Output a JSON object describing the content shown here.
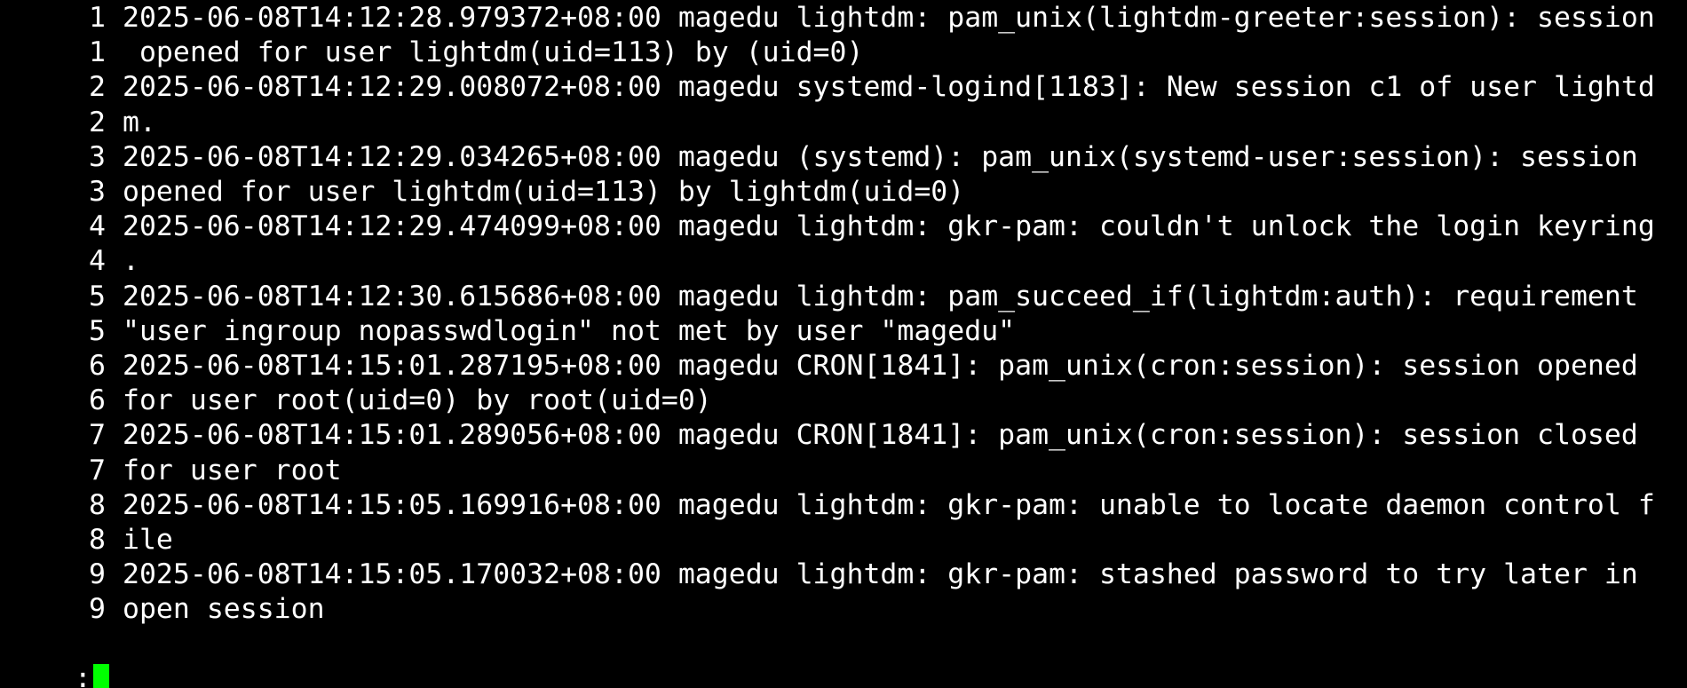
{
  "terminal": {
    "lines": [
      {
        "num": "1",
        "text": "2025-06-08T14:12:28.979372+08:00 magedu lightdm: pam_unix(lightdm-greeter:session): session"
      },
      {
        "num": "1",
        "text": " opened for user lightdm(uid=113) by (uid=0)"
      },
      {
        "num": "2",
        "text": "2025-06-08T14:12:29.008072+08:00 magedu systemd-logind[1183]: New session c1 of user lightd"
      },
      {
        "num": "2",
        "text": "m."
      },
      {
        "num": "3",
        "text": "2025-06-08T14:12:29.034265+08:00 magedu (systemd): pam_unix(systemd-user:session): session"
      },
      {
        "num": "3",
        "text": "opened for user lightdm(uid=113) by lightdm(uid=0)"
      },
      {
        "num": "4",
        "text": "2025-06-08T14:12:29.474099+08:00 magedu lightdm: gkr-pam: couldn't unlock the login keyring"
      },
      {
        "num": "4",
        "text": "."
      },
      {
        "num": "5",
        "text": "2025-06-08T14:12:30.615686+08:00 magedu lightdm: pam_succeed_if(lightdm:auth): requirement"
      },
      {
        "num": "5",
        "text": "\"user ingroup nopasswdlogin\" not met by user \"magedu\""
      },
      {
        "num": "6",
        "text": "2025-06-08T14:15:01.287195+08:00 magedu CRON[1841]: pam_unix(cron:session): session opened"
      },
      {
        "num": "6",
        "text": "for user root(uid=0) by root(uid=0)"
      },
      {
        "num": "7",
        "text": "2025-06-08T14:15:01.289056+08:00 magedu CRON[1841]: pam_unix(cron:session): session closed"
      },
      {
        "num": "7",
        "text": "for user root"
      },
      {
        "num": "8",
        "text": "2025-06-08T14:15:05.169916+08:00 magedu lightdm: gkr-pam: unable to locate daemon control f"
      },
      {
        "num": "8",
        "text": "ile"
      },
      {
        "num": "9",
        "text": "2025-06-08T14:15:05.170032+08:00 magedu lightdm: gkr-pam: stashed password to try later in"
      },
      {
        "num": "9",
        "text": "open session"
      }
    ],
    "prompt": ":",
    "cursor_color": "#00ff00",
    "background_color": "#000000",
    "text_color": "#ffffff"
  }
}
